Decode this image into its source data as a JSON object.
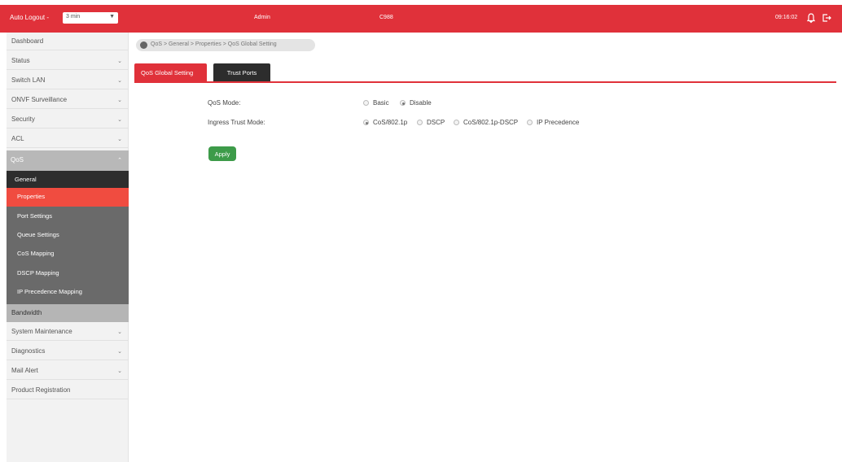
{
  "topbar": {
    "auto_logout_label": "Auto Logout -",
    "auto_logout_value": "3 min",
    "user": "Admin",
    "model": "C988",
    "time": "09:16:02"
  },
  "sidebar": {
    "items_top": [
      {
        "label": "Dashboard",
        "has_chevron": false
      },
      {
        "label": "Status",
        "has_chevron": true
      },
      {
        "label": "Switch LAN",
        "has_chevron": true
      },
      {
        "label": "ONVF Surveillance",
        "has_chevron": true
      },
      {
        "label": "Security",
        "has_chevron": true
      },
      {
        "label": "ACL",
        "has_chevron": true
      }
    ],
    "qos": {
      "label": "QoS",
      "general": "General",
      "subitems": [
        "Properties",
        "Port Settings",
        "Queue Settings",
        "CoS Mapping",
        "DSCP Mapping",
        "IP Precedence Mapping"
      ],
      "active": "Properties",
      "bandwidth": "Bandwidth"
    },
    "items_bottom": [
      {
        "label": "System Maintenance",
        "has_chevron": true
      },
      {
        "label": "Diagnostics",
        "has_chevron": true
      },
      {
        "label": "Mail Alert",
        "has_chevron": true
      },
      {
        "label": "Product Registration",
        "has_chevron": false
      }
    ]
  },
  "breadcrumb": "QoS > General > Properties > QoS Global Setting",
  "tabs": [
    {
      "label": "QoS Global Setting",
      "active": true
    },
    {
      "label": "Trust Ports",
      "active": false
    }
  ],
  "form": {
    "qos_mode": {
      "label": "QoS Mode:",
      "options": [
        "Basic",
        "Disable"
      ],
      "selected": "Disable"
    },
    "ingress_trust_mode": {
      "label": "Ingress Trust Mode:",
      "options": [
        "CoS/802.1p",
        "DSCP",
        "CoS/802.1p-DSCP",
        "IP Precedence"
      ],
      "selected": "CoS/802.1p"
    },
    "apply_label": "Apply"
  },
  "colors": {
    "accent": "#e0313a",
    "active_sub": "#f04c40",
    "apply": "#3d9b49",
    "dark": "#2d2d2d"
  }
}
